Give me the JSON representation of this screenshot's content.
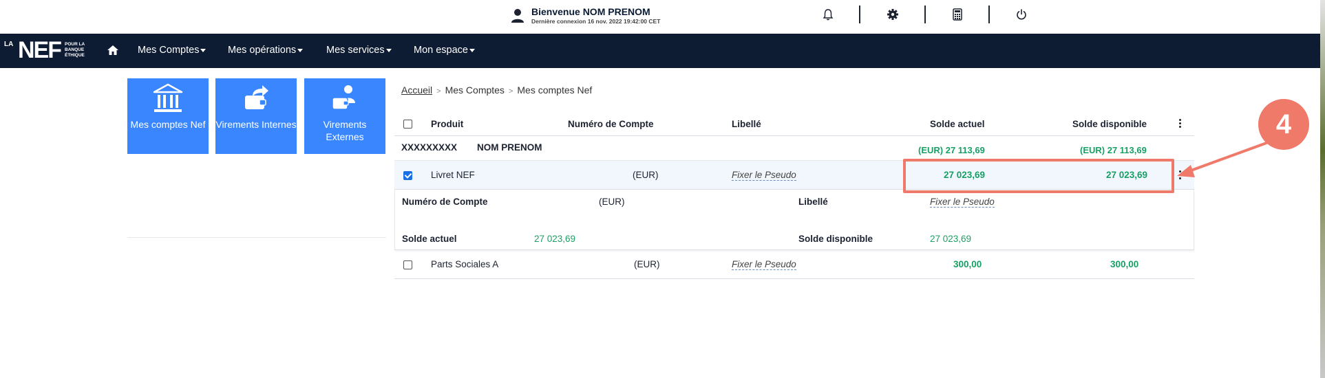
{
  "header": {
    "welcome_title": "Bienvenue NOM PRENOM",
    "last_login": "Dernière connexion 16 nov. 2022 19:42:00 CET",
    "icons": [
      "bell-icon",
      "gear-icon",
      "calculator-icon",
      "power-icon"
    ]
  },
  "nav": {
    "logo_la": "LA",
    "logo_nef": "NEF",
    "logo_tagline": "POUR LA BANQUE ÉTHIQUE",
    "items": [
      "Mes Comptes",
      "Mes opérations",
      "Mes services",
      "Mon espace"
    ]
  },
  "tiles": [
    {
      "label": "Mes comptes Nef",
      "icon": "bank-icon"
    },
    {
      "label": "Virements Internes",
      "icon": "wallet-transfer-icon"
    },
    {
      "label": "Virements Externes",
      "icon": "user-wallet-icon"
    }
  ],
  "breadcrumb": {
    "home": "Accueil",
    "level1": "Mes Comptes",
    "level2": "Mes comptes Nef"
  },
  "table": {
    "headers": {
      "produit": "Produit",
      "numero": "Numéro de Compte",
      "libelle": "Libellé",
      "solde_actuel": "Solde actuel",
      "solde_disponible": "Solde disponible"
    },
    "group": {
      "id": "XXXXXXXXX",
      "name": "NOM PRENOM",
      "solde_actuel": "(EUR) 27 113,69",
      "solde_disponible": "(EUR) 27 113,69"
    },
    "rows": [
      {
        "produit": "Livret NEF",
        "devise": "(EUR)",
        "pseudo": "Fixer le Pseudo",
        "solde_actuel": "27 023,69",
        "solde_disponible": "27 023,69",
        "checked": true
      },
      {
        "produit": "Parts Sociales A",
        "devise": "(EUR)",
        "pseudo": "Fixer le Pseudo",
        "solde_actuel": "300,00",
        "solde_disponible": "300,00",
        "checked": false
      }
    ],
    "detail": {
      "numero_label": "Numéro de Compte",
      "numero_value": "(EUR)",
      "libelle_label": "Libellé",
      "libelle_value": "Fixer le Pseudo",
      "solde_actuel_label": "Solde actuel",
      "solde_actuel_value": "27 023,69",
      "solde_disponible_label": "Solde disponible",
      "solde_disponible_value": "27 023,69"
    }
  },
  "annotation": {
    "badge": "4",
    "color": "#f07a6a"
  },
  "colors": {
    "nav_bg": "#0d1b33",
    "tile_bg": "#3a86ff",
    "green": "#1e9e63"
  }
}
